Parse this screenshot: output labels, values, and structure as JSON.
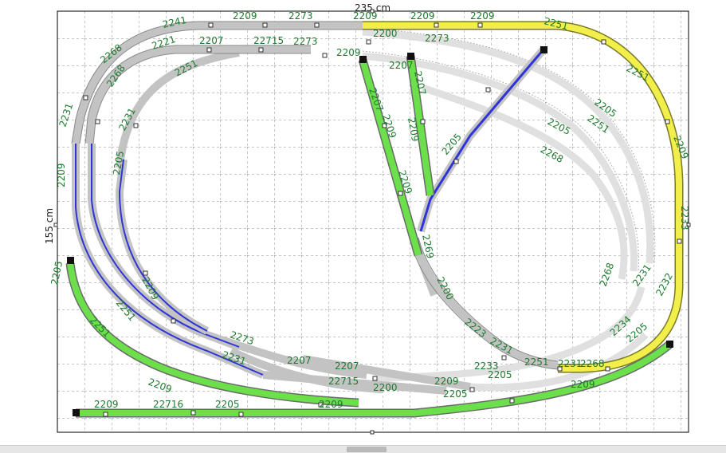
{
  "board": {
    "width_label": "235 cm",
    "height_label": "155 cm"
  },
  "colors": {
    "grid": "#8c8c8c",
    "border": "#000000",
    "track_gray": "#c3c3c3",
    "track_light": "#e0e0e0",
    "track_green": "#6be04a",
    "track_blue": "#2f34d8",
    "track_yellow": "#f2ef4a",
    "label": "#1d7a2e"
  },
  "labels": [
    {
      "id": "l1",
      "text": "2241"
    },
    {
      "id": "l2",
      "text": "2209"
    },
    {
      "id": "l3",
      "text": "2273"
    },
    {
      "id": "l4",
      "text": "2209"
    },
    {
      "id": "l5",
      "text": "2209"
    },
    {
      "id": "l6",
      "text": "2209"
    },
    {
      "id": "l7",
      "text": "2251"
    },
    {
      "id": "l8",
      "text": "2268"
    },
    {
      "id": "l9",
      "text": "2221"
    },
    {
      "id": "l10",
      "text": "2207"
    },
    {
      "id": "l11",
      "text": "22715"
    },
    {
      "id": "l12",
      "text": "2273"
    },
    {
      "id": "l13",
      "text": "2200"
    },
    {
      "id": "l14",
      "text": "2273"
    },
    {
      "id": "l15",
      "text": "2251"
    },
    {
      "id": "l16",
      "text": "2209"
    },
    {
      "id": "l17",
      "text": "2207"
    },
    {
      "id": "l18",
      "text": "2207"
    },
    {
      "id": "l19",
      "text": "2207"
    },
    {
      "id": "l20",
      "text": "2251"
    },
    {
      "id": "l21",
      "text": "2231"
    },
    {
      "id": "l22",
      "text": "2268"
    },
    {
      "id": "l23",
      "text": "2231"
    },
    {
      "id": "l24",
      "text": "2209"
    },
    {
      "id": "l25",
      "text": "2209"
    },
    {
      "id": "l26",
      "text": "2209"
    },
    {
      "id": "l27",
      "text": "2209"
    },
    {
      "id": "l28",
      "text": "2205"
    },
    {
      "id": "l29",
      "text": "2205"
    },
    {
      "id": "l30",
      "text": "2205"
    },
    {
      "id": "l31",
      "text": "2251"
    },
    {
      "id": "l32",
      "text": "2209"
    },
    {
      "id": "l33",
      "text": "2233"
    },
    {
      "id": "l34",
      "text": "2205"
    },
    {
      "id": "l35",
      "text": "2268"
    },
    {
      "id": "l36",
      "text": "2269"
    },
    {
      "id": "l37",
      "text": "2200"
    },
    {
      "id": "l38",
      "text": "2223"
    },
    {
      "id": "l39",
      "text": "2231"
    },
    {
      "id": "l40",
      "text": "2251"
    },
    {
      "id": "l41",
      "text": "2231"
    },
    {
      "id": "l42",
      "text": "2268"
    },
    {
      "id": "l43",
      "text": "2268"
    },
    {
      "id": "l44",
      "text": "2231"
    },
    {
      "id": "l45",
      "text": "2232"
    },
    {
      "id": "l46",
      "text": "2234"
    },
    {
      "id": "l47",
      "text": "2205"
    },
    {
      "id": "l48",
      "text": "2209"
    },
    {
      "id": "l49",
      "text": "2233"
    },
    {
      "id": "l50",
      "text": "2205"
    },
    {
      "id": "l51",
      "text": "2251"
    },
    {
      "id": "l52",
      "text": "2251"
    },
    {
      "id": "l53",
      "text": "2209"
    },
    {
      "id": "l54",
      "text": "2209"
    },
    {
      "id": "l55",
      "text": "22716"
    },
    {
      "id": "l56",
      "text": "2205"
    },
    {
      "id": "l57",
      "text": "2209"
    },
    {
      "id": "l58",
      "text": "2273"
    },
    {
      "id": "l59",
      "text": "2207"
    },
    {
      "id": "l60",
      "text": "2207"
    },
    {
      "id": "l61",
      "text": "22715"
    },
    {
      "id": "l62",
      "text": "2200"
    },
    {
      "id": "l63",
      "text": "2209"
    },
    {
      "id": "l64",
      "text": "2205"
    },
    {
      "id": "l65",
      "text": "2209"
    },
    {
      "id": "l66",
      "text": "2205"
    },
    {
      "id": "l67",
      "text": "2231"
    }
  ]
}
